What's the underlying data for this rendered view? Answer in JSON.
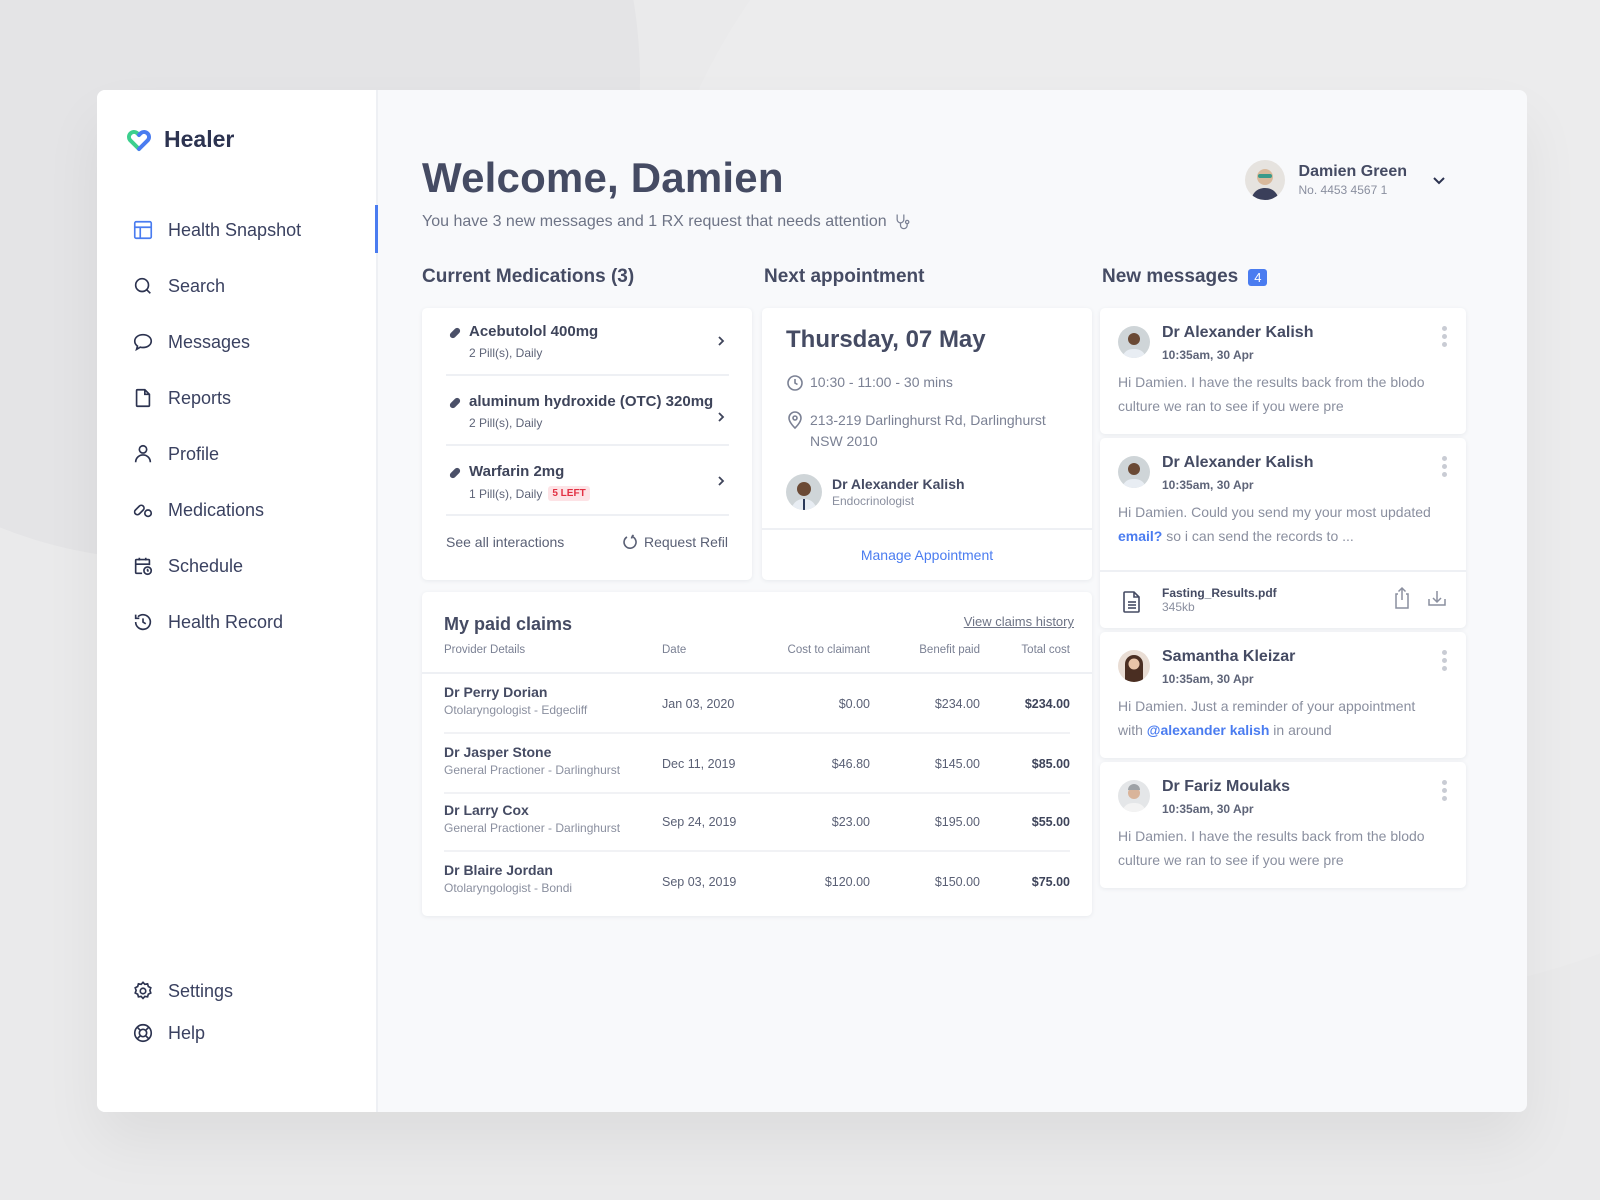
{
  "app": {
    "name": "Healer",
    "brand_colors": {
      "accent": "#4a7cf0",
      "logo_green": "#3ccf8e",
      "logo_blue": "#4a7cf0",
      "alert_red": "#e23043"
    }
  },
  "sidebar": {
    "items": [
      {
        "label": "Health Snapshot",
        "icon": "layout-icon",
        "active": true
      },
      {
        "label": "Search",
        "icon": "search-icon",
        "active": false
      },
      {
        "label": "Messages",
        "icon": "chat-bubble-icon",
        "active": false
      },
      {
        "label": "Reports",
        "icon": "document-icon",
        "active": false
      },
      {
        "label": "Profile",
        "icon": "user-icon",
        "active": false
      },
      {
        "label": "Medications",
        "icon": "pills-icon",
        "active": false
      },
      {
        "label": "Schedule",
        "icon": "calendar-clock-icon",
        "active": false
      },
      {
        "label": "Health Record",
        "icon": "history-icon",
        "active": false
      }
    ],
    "bottom_items": [
      {
        "label": "Settings",
        "icon": "gear-icon"
      },
      {
        "label": "Help",
        "icon": "lifebuoy-icon"
      }
    ]
  },
  "header": {
    "title": "Welcome, Damien",
    "subtitle": "You have 3 new messages and 1 RX request that needs attention",
    "user": {
      "name": "Damien Green",
      "number": "No. 4453 4567 1"
    }
  },
  "medications": {
    "title": "Current Medications (3)",
    "items": [
      {
        "name": "Acebutolol 400mg",
        "dose": "2 Pill(s), Daily",
        "badge": null
      },
      {
        "name": "aluminum hydroxide (OTC) 320mg",
        "dose": "2 Pill(s), Daily",
        "badge": null
      },
      {
        "name": "Warfarin 2mg",
        "dose": "1 Pill(s), Daily",
        "badge": "5 LEFT"
      }
    ],
    "see_all": "See all interactions",
    "refill": "Request Refil"
  },
  "appointment": {
    "title": "Next appointment",
    "date": "Thursday, 07 May",
    "time": "10:30 - 11:00 - 30 mins",
    "address_line1": "213-219 Darlinghurst Rd, Darlinghurst",
    "address_line2": "NSW 2010",
    "doctor": {
      "name": "Dr Alexander Kalish",
      "role": "Endocrinologist"
    },
    "manage": "Manage Appointment"
  },
  "claims": {
    "title": "My paid claims",
    "history_link": "View claims history",
    "columns": [
      "Provider Details",
      "Date",
      "Cost to claimant",
      "Benefit paid",
      "Total cost"
    ],
    "rows": [
      {
        "name": "Dr Perry Dorian",
        "sub": "Otolaryngologist - Edgecliff",
        "date": "Jan 03, 2020",
        "cost": "$0.00",
        "benefit": "$234.00",
        "total": "$234.00"
      },
      {
        "name": "Dr Jasper Stone",
        "sub": "General Practioner - Darlinghurst",
        "date": "Dec 11, 2019",
        "cost": "$46.80",
        "benefit": "$145.00",
        "total": "$85.00"
      },
      {
        "name": "Dr Larry Cox",
        "sub": "General Practioner - Darlinghurst",
        "date": "Sep 24, 2019",
        "cost": "$23.00",
        "benefit": "$195.00",
        "total": "$55.00"
      },
      {
        "name": "Dr Blaire Jordan",
        "sub": "Otolaryngologist - Bondi",
        "date": "Sep 03, 2019",
        "cost": "$120.00",
        "benefit": "$150.00",
        "total": "$75.00"
      }
    ]
  },
  "messages": {
    "title": "New messages",
    "count": "4",
    "items": [
      {
        "name": "Dr Alexander Kalish",
        "time": "10:35am, 30 Apr",
        "body": "Hi Damien. I have the results back from the blodo culture we ran to see if you were pre"
      },
      {
        "name": "Dr Alexander Kalish",
        "time": "10:35am, 30 Apr",
        "body_pre": "Hi Damien. Could you send my your most updated ",
        "link": "email?",
        "body_post": " so i can send the records to ...",
        "attachment": {
          "name": "Fasting_Results.pdf",
          "size": "345kb"
        }
      },
      {
        "name": "Samantha Kleizar",
        "time": "10:35am, 30 Apr",
        "body_pre": "Hi Damien. Just a reminder of your appointment with ",
        "mention": "@alexander kalish",
        "body_post": " in around"
      },
      {
        "name": "Dr Fariz Moulaks",
        "time": "10:35am, 30 Apr",
        "body": "Hi Damien. I have the results back from the blodo culture we ran to see if you were pre"
      }
    ]
  }
}
